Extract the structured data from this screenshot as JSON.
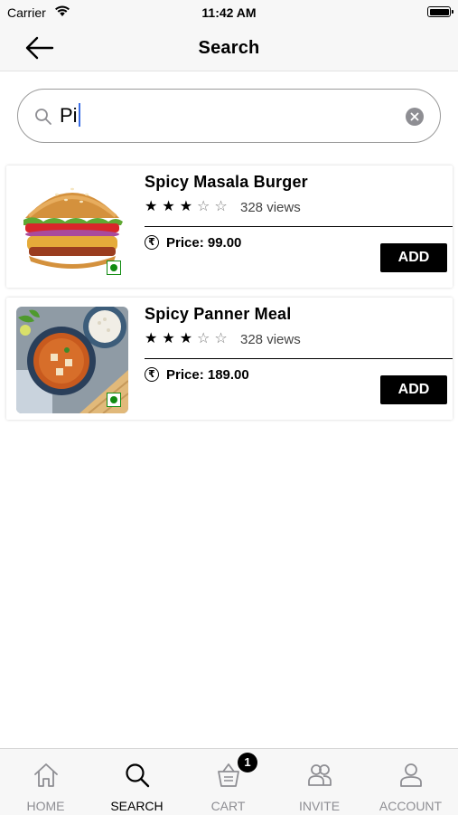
{
  "status_bar": {
    "carrier": "Carrier",
    "time": "11:42 AM"
  },
  "header": {
    "title": "Search",
    "back_icon": "arrow-left-icon"
  },
  "search": {
    "query": "Pi",
    "search_icon": "search-icon",
    "clear_icon": "clear-icon"
  },
  "results": [
    {
      "name": "Spicy Masala Burger",
      "rating": 3,
      "rating_max": 5,
      "views": "328 views",
      "price": "Price: 99.00",
      "add_label": "ADD",
      "veg": true
    },
    {
      "name": "Spicy Panner Meal",
      "rating": 3,
      "rating_max": 5,
      "views": "328 views",
      "price": "Price: 189.00",
      "add_label": "ADD",
      "veg": true
    }
  ],
  "tabs": [
    {
      "label": "HOME",
      "icon": "home-icon",
      "active": false
    },
    {
      "label": "SEARCH",
      "icon": "search-icon",
      "active": true
    },
    {
      "label": "CART",
      "icon": "cart-icon",
      "active": false,
      "badge": "1"
    },
    {
      "label": "INVITE",
      "icon": "invite-icon",
      "active": false
    },
    {
      "label": "ACCOUNT",
      "icon": "account-icon",
      "active": false
    }
  ],
  "colors": {
    "accent": "#000000",
    "veg_green": "#118b11",
    "inactive_tab": "#8e8e93",
    "bar_bg": "#f7f7f7"
  }
}
